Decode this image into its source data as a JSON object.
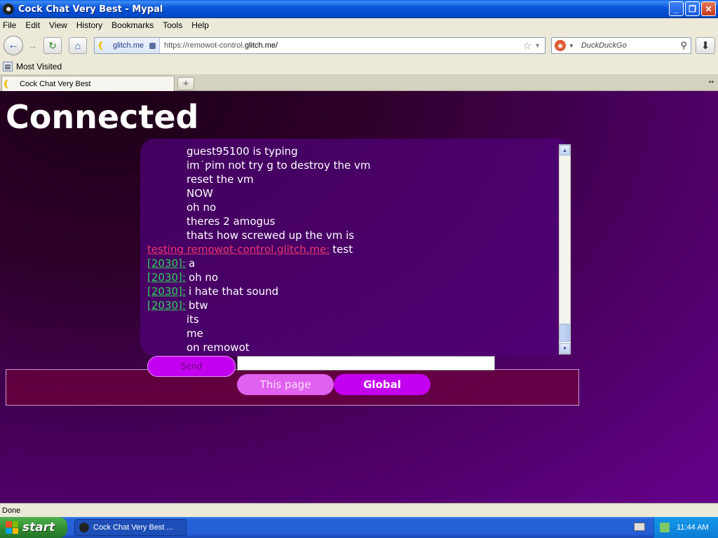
{
  "window": {
    "title": "Cock Chat Very Best - Mypal",
    "minimize": "_",
    "maximize": "❐",
    "close": "✕"
  },
  "menu": [
    "File",
    "Edit",
    "View",
    "History",
    "Bookmarks",
    "Tools",
    "Help"
  ],
  "nav": {
    "identity_domain": "glitch.me",
    "url_prefix": "https://remowot-control.",
    "url_host": "glitch.me/",
    "search_placeholder": "DuckDuckGo"
  },
  "bookmarks": {
    "most_visited": "Most Visited"
  },
  "tabs": [
    {
      "label": "Cock Chat Very Best"
    }
  ],
  "page": {
    "heading": "Connected",
    "messages": [
      {
        "user": "",
        "text": "guest95100 is typing"
      },
      {
        "user": "",
        "text": "im˙ƿim not try    g to destroy the vm"
      },
      {
        "user": "",
        "text": "reset the vm"
      },
      {
        "user": "",
        "text": "NOW"
      },
      {
        "user": "",
        "text": "oh no"
      },
      {
        "user": "",
        "text": "theres 2 amogus"
      },
      {
        "user": "",
        "text": "thats how screwed up the vm is"
      },
      {
        "user": "testing remowot-control.glitch.me:",
        "text": "test",
        "color": "red"
      },
      {
        "user": "[2030]:",
        "text": "a",
        "color": "green"
      },
      {
        "user": "[2030]:",
        "text": "oh no",
        "color": "green"
      },
      {
        "user": "[2030]:",
        "text": "i hate that sound",
        "color": "green"
      },
      {
        "user": "[2030]:",
        "text": "btw",
        "color": "green"
      },
      {
        "user": "",
        "text": "its"
      },
      {
        "user": "",
        "text": "me"
      },
      {
        "user": "",
        "text": "on remowot"
      }
    ],
    "send_label": "Send",
    "input_value": "",
    "tab_this_page": "This page",
    "tab_global": "Global"
  },
  "status": {
    "text": "Done"
  },
  "taskbar": {
    "start_label": "start",
    "task_label": "Cock Chat Very Best ...",
    "clock": "11:44 AM"
  },
  "colors": {
    "accent": "#c400f0",
    "user_green": "#2ee85c",
    "user_red": "#ff3c6e"
  }
}
